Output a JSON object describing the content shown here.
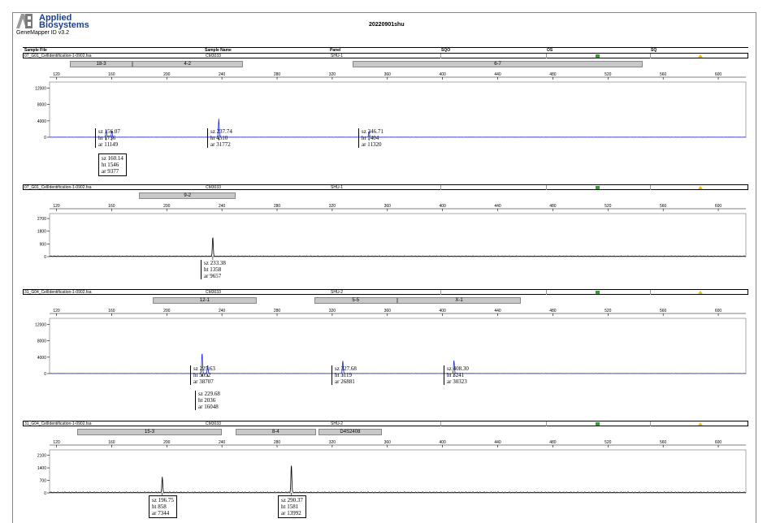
{
  "header": {
    "logo_line1": "Applied",
    "logo_line2": "Biosystems",
    "app_version": "GeneMapper ID v3.2",
    "title": "20220901shu"
  },
  "columns": {
    "sample_file": "Sample File",
    "sample_name": "Sample Name",
    "panel": "Panel",
    "sqo": "SQO",
    "os": "OS",
    "sq": "SQ"
  },
  "colors": {
    "blue_trace": "#1f2fd6",
    "black_trace": "#000000",
    "flag_green": "#22aa22",
    "flag_yellow": "#e8c000"
  },
  "chart_data": [
    {
      "type": "line",
      "sample_file": "07_G01_CellIdentification-1-0902.fsa",
      "sample_name": "CM3033",
      "panel": "SHU-1",
      "color": "#1f2fd6",
      "x_ticks": [
        120,
        160,
        200,
        240,
        280,
        320,
        360,
        400,
        440,
        480,
        520,
        560,
        600
      ],
      "xlim": [
        115,
        620
      ],
      "y_ticks": [
        0,
        4000,
        8000,
        12000
      ],
      "ylim": [
        0,
        13500
      ],
      "bins": [
        {
          "label": "18-3",
          "start": 130,
          "end": 175
        },
        {
          "label": "4-2",
          "start": 175,
          "end": 255
        },
        {
          "label": "6-7",
          "start": 335,
          "end": 545
        }
      ],
      "peaks": [
        {
          "sz": "156.07",
          "ht": "1736",
          "ar": "11149"
        },
        {
          "sz": "160.14",
          "ht": "1546",
          "ar": "9377"
        },
        {
          "sz": "237.74",
          "ht": "4510",
          "ar": "31772"
        },
        {
          "sz": "346.71",
          "ht": "1404",
          "ar": "11320"
        }
      ]
    },
    {
      "type": "line",
      "sample_file": "07_G01_CellIdentification-1-0902.fsa",
      "sample_name": "CM3033",
      "panel": "SHU-1",
      "color": "#000000",
      "x_ticks": [
        120,
        160,
        200,
        240,
        280,
        320,
        360,
        400,
        440,
        480,
        520,
        560,
        600
      ],
      "xlim": [
        115,
        620
      ],
      "y_ticks": [
        0,
        900,
        1800,
        2700
      ],
      "ylim": [
        0,
        3050
      ],
      "bins": [
        {
          "label": "9-2",
          "start": 180,
          "end": 250
        }
      ],
      "peaks": [
        {
          "sz": "233.38",
          "ht": "1358",
          "ar": "9657"
        }
      ]
    },
    {
      "type": "line",
      "sample_file": "31_G04_CellIdentification-1-0902.fsa",
      "sample_name": "CM3033",
      "panel": "SHU-2",
      "color": "#1f2fd6",
      "x_ticks": [
        120,
        160,
        200,
        240,
        280,
        320,
        360,
        400,
        440,
        480,
        520,
        560,
        600
      ],
      "xlim": [
        115,
        620
      ],
      "y_ticks": [
        0,
        4000,
        8000,
        12000
      ],
      "ylim": [
        0,
        13500
      ],
      "bins": [
        {
          "label": "12-1",
          "start": 190,
          "end": 265
        },
        {
          "label": "5-5",
          "start": 307,
          "end": 367
        },
        {
          "label": "X-1",
          "start": 367,
          "end": 457
        }
      ],
      "peaks": [
        {
          "sz": "225.63",
          "ht": "5052",
          "ar": "38707"
        },
        {
          "sz": "229.68",
          "ht": "2036",
          "ar": "16048"
        },
        {
          "sz": "327.68",
          "ht": "3119",
          "ar": "26881"
        },
        {
          "sz": "408.30",
          "ht": "3241",
          "ar": "30323"
        }
      ]
    },
    {
      "type": "line",
      "sample_file": "31_G04_CellIdentification-1-0902.fsa",
      "sample_name": "CM3033",
      "panel": "SHU-2",
      "color": "#000000",
      "x_ticks": [
        120,
        160,
        200,
        240,
        280,
        320,
        360,
        400,
        440,
        480,
        520,
        560,
        600
      ],
      "xlim": [
        115,
        620
      ],
      "y_ticks": [
        0,
        700,
        1400,
        2100
      ],
      "ylim": [
        0,
        2400
      ],
      "bins": [
        {
          "label": "15-3",
          "start": 135,
          "end": 240
        },
        {
          "label": "8-4",
          "start": 250,
          "end": 308
        },
        {
          "label": "D4S2408",
          "start": 310,
          "end": 356
        }
      ],
      "peaks": [
        {
          "sz": "196.75",
          "ht": "858",
          "ar": "7344"
        },
        {
          "sz": "290.37",
          "ht": "1581",
          "ar": "13992"
        }
      ]
    }
  ]
}
